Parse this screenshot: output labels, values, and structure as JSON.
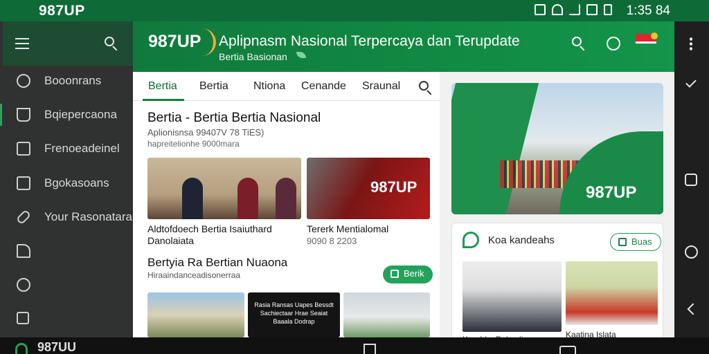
{
  "status_bar": {
    "brand": "987UP",
    "clock": "1:35 84"
  },
  "drawer": {
    "items": [
      {
        "label": "Booonrans",
        "icon": "search-icon"
      },
      {
        "label": "Bqiepercaona",
        "icon": "filter-icon"
      },
      {
        "label": "Frenoeadeinel",
        "icon": "square-icon"
      },
      {
        "label": "Bgokasoans",
        "icon": "bookmark-icon"
      },
      {
        "label": "Your Rasonatara",
        "icon": "link-icon"
      },
      {
        "label": "",
        "icon": "share-icon"
      },
      {
        "label": "",
        "icon": "power-icon"
      },
      {
        "label": "",
        "icon": "settings-box-icon"
      }
    ]
  },
  "app_bar": {
    "logo": "987UP",
    "title": "Aplipnasm Nasional Terpercaya dan Terupdate",
    "subtitle": "Bertia Basionan"
  },
  "tabs": [
    "Bertia",
    "Bertia",
    "Ntiona",
    "Cenande",
    "Sraunal"
  ],
  "feed": {
    "headline": "Bertia - Bertia Bertia Nasional",
    "meta_line1": "Aplionisnsa 99407V 78 TiES)",
    "meta_line2": "hapreitelionhe 9000mara",
    "article1_caption": "Aldtofdoech Bertia Isaiuthard Danolaiata",
    "article2_thumb_text": "987UP",
    "article2_caption": "Tererk Mentialomal",
    "article2_date": "9090 8 2203",
    "section2_title": "Bertyia Ra Bertian Nuaona",
    "section2_meta": "Hiraaindanceadisonerraa",
    "section2_button": "Berik",
    "thumb4_text": "Rasia Ransas Uapes Bessdt Sachiectaar Hrae Seaiat Baaala Dodrap"
  },
  "side": {
    "hero_label": "987UP",
    "card_title": "Koa kandeahs",
    "card_button": "Buas",
    "cap_left": "Korahka Belsndi",
    "cap_right": "Kaatina Islata"
  },
  "nav_bar": {
    "brand": "987UU"
  }
}
